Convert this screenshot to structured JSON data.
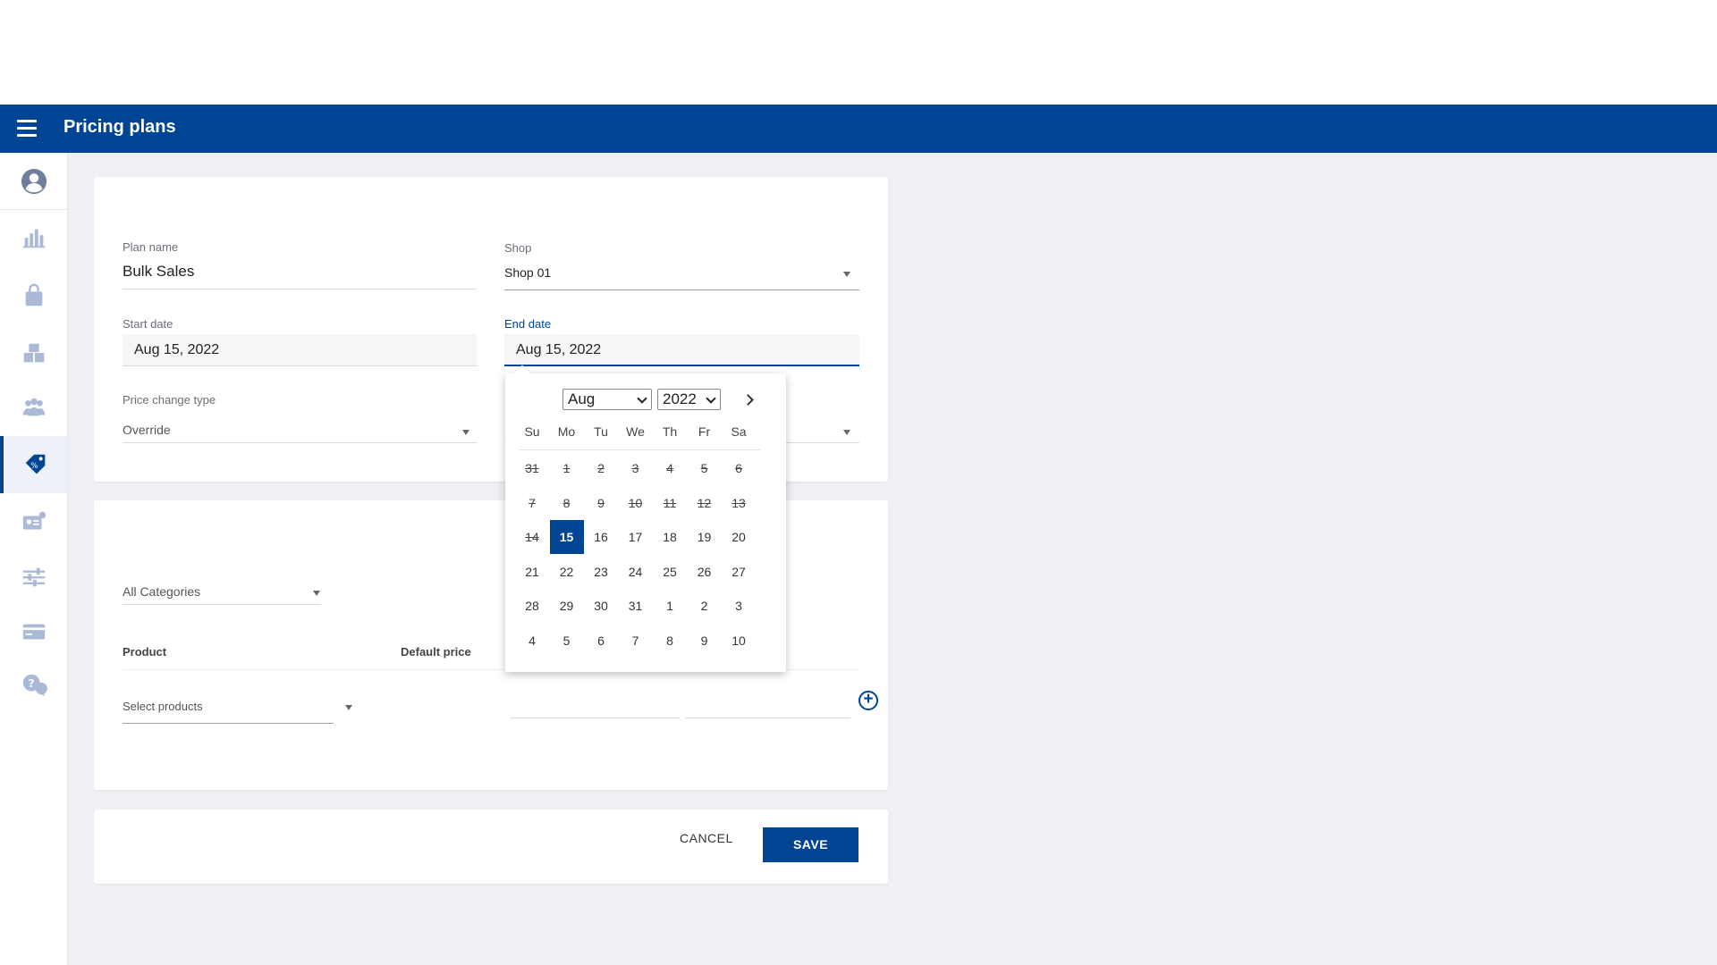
{
  "header": {
    "title": "Pricing plans"
  },
  "sidebar": {
    "items": [
      {
        "icon": "user-circle-icon"
      },
      {
        "icon": "bar-chart-icon"
      },
      {
        "icon": "shopping-bag-icon"
      },
      {
        "icon": "warehouse-boxes-icon"
      },
      {
        "icon": "people-group-icon"
      },
      {
        "icon": "price-tag-icon",
        "active": true
      },
      {
        "icon": "id-card-icon"
      },
      {
        "icon": "sliders-icon"
      },
      {
        "icon": "credit-card-icon"
      },
      {
        "icon": "help-chat-icon"
      }
    ]
  },
  "form": {
    "plan_name_label": "Plan name",
    "plan_name_value": "Bulk Sales",
    "shop_label": "Shop",
    "shop_value": "Shop 01",
    "start_date_label": "Start date",
    "start_date_value": "Aug 15, 2022",
    "end_date_label": "End date",
    "end_date_value": "Aug 15, 2022",
    "price_change_label": "Price change type",
    "price_change_value": "Override"
  },
  "products": {
    "category_placeholder": "All Categories",
    "col_product": "Product",
    "col_default_price": "Default price",
    "select_products_placeholder": "Select products",
    "add_icon": "plus-circle-icon"
  },
  "actions": {
    "cancel": "CANCEL",
    "save": "SAVE"
  },
  "calendar": {
    "month": "Aug",
    "year": "2022",
    "weekdays": [
      "Su",
      "Mo",
      "Tu",
      "We",
      "Th",
      "Fr",
      "Sa"
    ],
    "weeks": [
      [
        "31",
        "1",
        "2",
        "3",
        "4",
        "5",
        "6"
      ],
      [
        "7",
        "8",
        "9",
        "10",
        "11",
        "12",
        "13"
      ],
      [
        "14",
        "15",
        "16",
        "17",
        "18",
        "19",
        "20"
      ],
      [
        "21",
        "22",
        "23",
        "24",
        "25",
        "26",
        "27"
      ],
      [
        "28",
        "29",
        "30",
        "31",
        "1",
        "2",
        "3"
      ],
      [
        "4",
        "5",
        "6",
        "7",
        "8",
        "9",
        "10"
      ]
    ],
    "disabled_through_index": 14,
    "selected_index": 15
  },
  "colors": {
    "brand": "#004494",
    "page_bg": "#eff0f4"
  }
}
